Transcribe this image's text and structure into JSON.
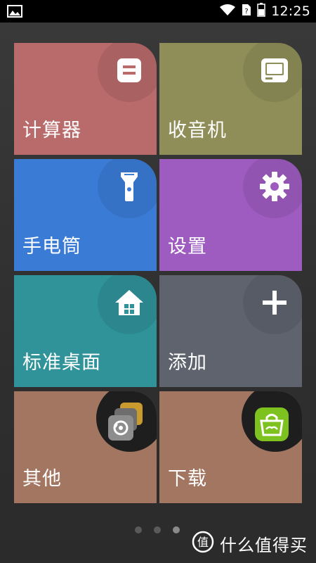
{
  "status_bar": {
    "time": "12:25",
    "icons": [
      "image-icon",
      "wifi-icon",
      "sim-icon",
      "battery-icon"
    ]
  },
  "tiles": [
    {
      "label": "计算器",
      "icon": "calculator-icon",
      "color": "#b96a6a"
    },
    {
      "label": "收音机",
      "icon": "radio-icon",
      "color": "#8f8e58"
    },
    {
      "label": "手电筒",
      "icon": "flashlight-icon",
      "color": "#3a7bd5"
    },
    {
      "label": "设置",
      "icon": "gear-icon",
      "color": "#9e5cc0"
    },
    {
      "label": "标准桌面",
      "icon": "home-icon",
      "color": "#2f9399"
    },
    {
      "label": "添加",
      "icon": "plus-icon",
      "color": "#5f636e"
    },
    {
      "label": "其他",
      "icon": "folder-stack-icon",
      "color": "#a37661"
    },
    {
      "label": "下载",
      "icon": "store-bag-icon",
      "color": "#a37661"
    }
  ],
  "pager": {
    "count": 3,
    "active": 2
  },
  "watermark": {
    "text": "什么值得买",
    "icon": "zhi-logo-icon"
  }
}
